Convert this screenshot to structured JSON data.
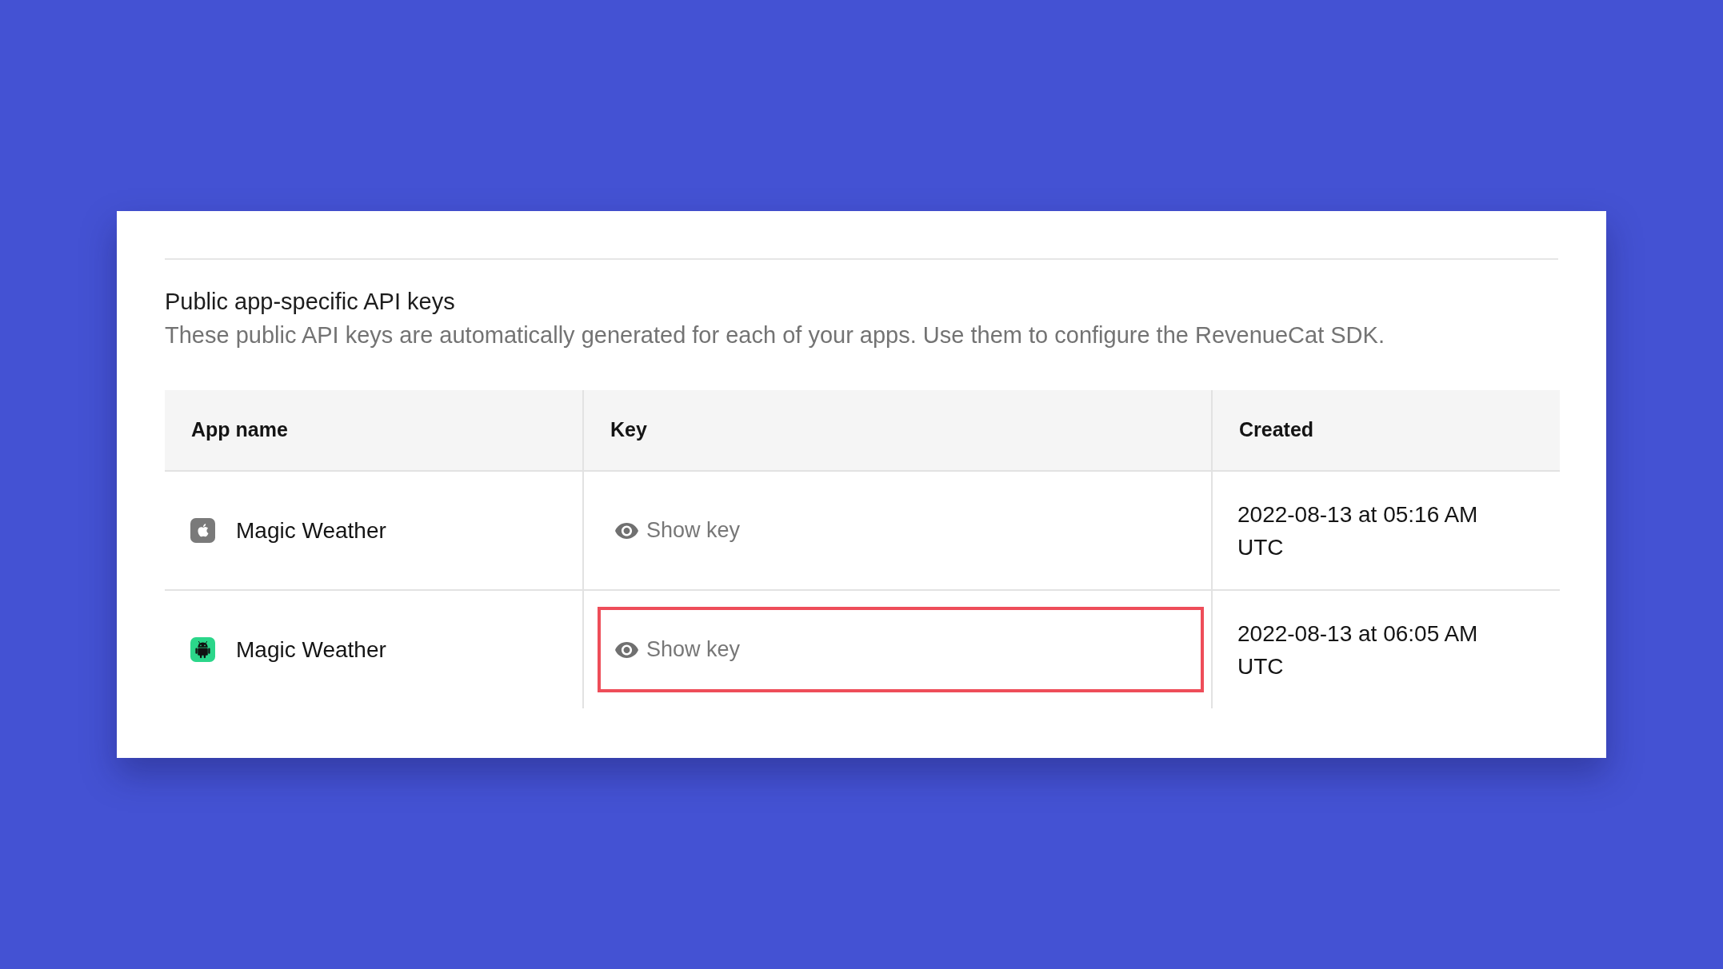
{
  "section": {
    "title": "Public app-specific API keys",
    "description": "These public API keys are automatically generated for each of your apps. Use them to configure the RevenueCat SDK."
  },
  "table": {
    "columns": [
      "App name",
      "Key",
      "Created"
    ],
    "rows": [
      {
        "kind": "apple",
        "app_name": "Magic Weather",
        "key_action": "Show key",
        "created": "2022-08-13 at 05:16 AM UTC",
        "highlighted": false
      },
      {
        "kind": "android",
        "app_name": "Magic Weather",
        "key_action": "Show key",
        "created": "2022-08-13 at 06:05 AM UTC",
        "highlighted": true
      }
    ]
  }
}
